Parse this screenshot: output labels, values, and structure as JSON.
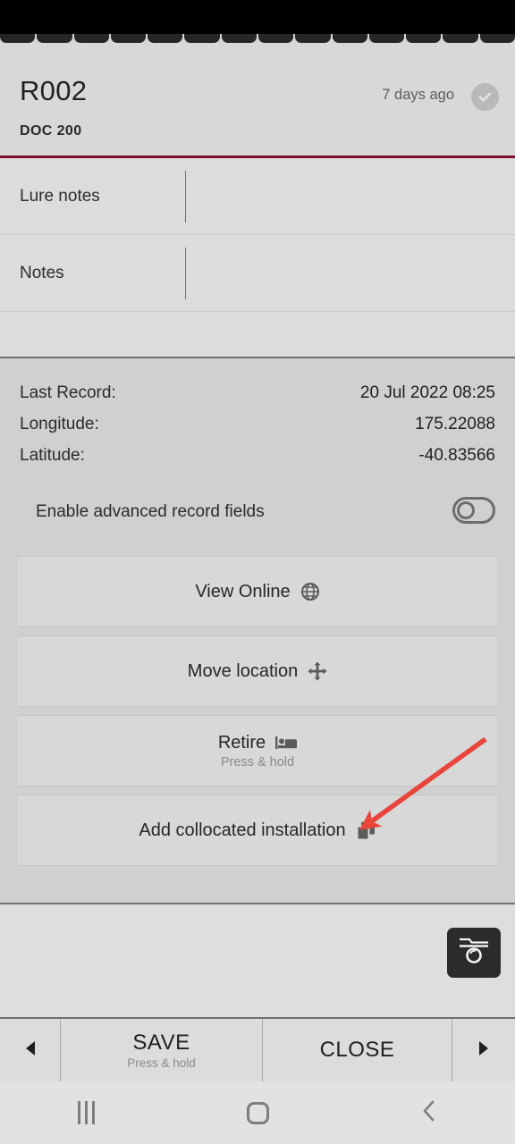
{
  "header": {
    "record_id": "R002",
    "record_code": "DOC 200",
    "age_label": "7 days ago",
    "status_icon": "check-circle-icon",
    "accent_color": "#7d1127"
  },
  "tabstrip": {
    "segment_count": 14,
    "active_index": 2,
    "marker_icon": "triangle-up-icon"
  },
  "notes": [
    {
      "label": "Lure notes",
      "value": "",
      "placeholder": ""
    },
    {
      "label": "Notes",
      "value": "",
      "placeholder": ""
    }
  ],
  "details": [
    {
      "key": "Last Record:",
      "value": "20 Jul 2022 08:25"
    },
    {
      "key": "Longitude:",
      "value": "175.22088"
    },
    {
      "key": "Latitude:",
      "value": "-40.83566"
    }
  ],
  "advanced_toggle": {
    "label": "Enable advanced record fields",
    "state": "off"
  },
  "actions": [
    {
      "label": "View Online",
      "sub": "",
      "icon": "globe-icon"
    },
    {
      "label": "Move location",
      "sub": "",
      "icon": "move-arrows-icon"
    },
    {
      "label": "Retire",
      "sub": "Press & hold",
      "icon": "bed-icon"
    },
    {
      "label": "Add collocated installation",
      "sub": "",
      "icon": "copy-icon"
    }
  ],
  "camera": {
    "icon": "camera-icon"
  },
  "bottombar": {
    "prev_icon": "triangle-left-icon",
    "save_label": "SAVE",
    "save_sub": "Press & hold",
    "close_label": "CLOSE",
    "next_icon": "triangle-right-icon"
  },
  "navbar": {
    "recents_icon": "recents-icon",
    "home_icon": "home-icon",
    "back_icon": "back-chevron-icon"
  },
  "annotation": {
    "type": "arrow",
    "color": "#e8453c",
    "points_at": "Add collocated installation"
  }
}
